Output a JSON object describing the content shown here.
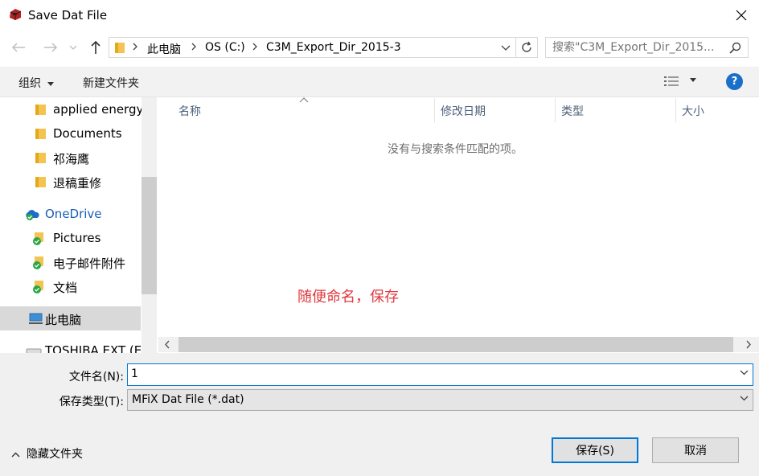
{
  "window": {
    "title": "Save Dat File"
  },
  "address": {
    "crumbs": [
      "此电脑",
      "OS (C:)",
      "C3M_Export_Dir_2015-3"
    ]
  },
  "search": {
    "placeholder": "搜索\"C3M_Export_Dir_2015..."
  },
  "toolbar": {
    "organize_label": "组织",
    "new_folder_label": "新建文件夹",
    "help_label": "?"
  },
  "nav": {
    "items": [
      {
        "label": "applied energy",
        "icon": "folder-icon"
      },
      {
        "label": "Documents",
        "icon": "folder-icon"
      },
      {
        "label": "祁海鹰",
        "icon": "folder-icon"
      },
      {
        "label": "退稿重修",
        "icon": "folder-icon"
      },
      {
        "label": "OneDrive",
        "icon": "onedrive-icon"
      },
      {
        "label": "Pictures",
        "icon": "synced-folder-icon"
      },
      {
        "label": "电子邮件附件",
        "icon": "synced-folder-icon"
      },
      {
        "label": "文档",
        "icon": "synced-folder-icon"
      },
      {
        "label": "此电脑",
        "icon": "computer-icon"
      },
      {
        "label": "TOSHIBA EXT (E:",
        "icon": "drive-icon"
      }
    ]
  },
  "file_list": {
    "columns": [
      "名称",
      "修改日期",
      "类型",
      "大小"
    ],
    "empty_message": "没有与搜索条件匹配的项。",
    "annotation": "随便命名，保存"
  },
  "form": {
    "filename_label": "文件名(N):",
    "filename_value": "1",
    "filetype_label": "保存类型(T):",
    "filetype_value": "MFiX Dat File (*.dat)"
  },
  "footer": {
    "hide_folders_label": "隐藏文件夹",
    "save_label": "保存(S)",
    "cancel_label": "取消"
  },
  "colors": {
    "accent": "#0078d7",
    "annotation": "#e0393e",
    "selection": "#d9d9d9"
  }
}
